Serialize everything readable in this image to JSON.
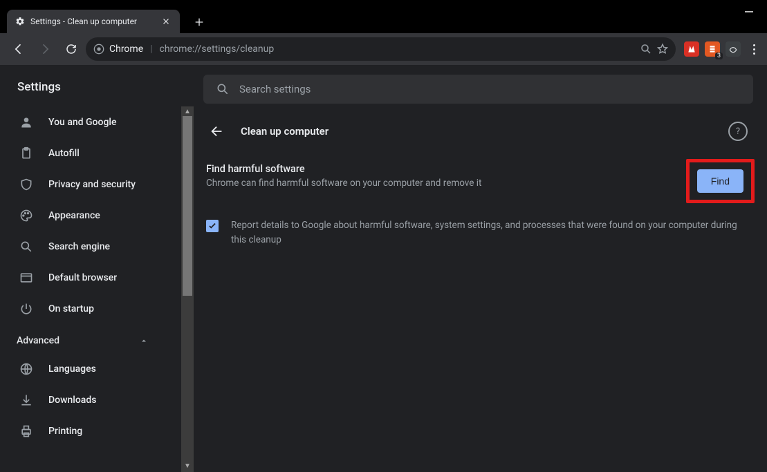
{
  "window": {
    "tab_title": "Settings - Clean up computer"
  },
  "omnibox": {
    "chrome_label": "Chrome",
    "url": "chrome://settings/cleanup"
  },
  "extensions": {
    "badge": "3"
  },
  "sidebar": {
    "title": "Settings",
    "items": [
      {
        "label": "You and Google"
      },
      {
        "label": "Autofill"
      },
      {
        "label": "Privacy and security"
      },
      {
        "label": "Appearance"
      },
      {
        "label": "Search engine"
      },
      {
        "label": "Default browser"
      },
      {
        "label": "On startup"
      }
    ],
    "advanced_label": "Advanced",
    "advanced_items": [
      {
        "label": "Languages"
      },
      {
        "label": "Downloads"
      },
      {
        "label": "Printing"
      }
    ]
  },
  "search": {
    "placeholder": "Search settings"
  },
  "page": {
    "title": "Clean up computer",
    "find_heading": "Find harmful software",
    "find_desc": "Chrome can find harmful software on your computer and remove it",
    "find_button": "Find",
    "report_label": "Report details to Google about harmful software, system settings, and processes that were found on your computer during this cleanup",
    "report_checked": true
  }
}
